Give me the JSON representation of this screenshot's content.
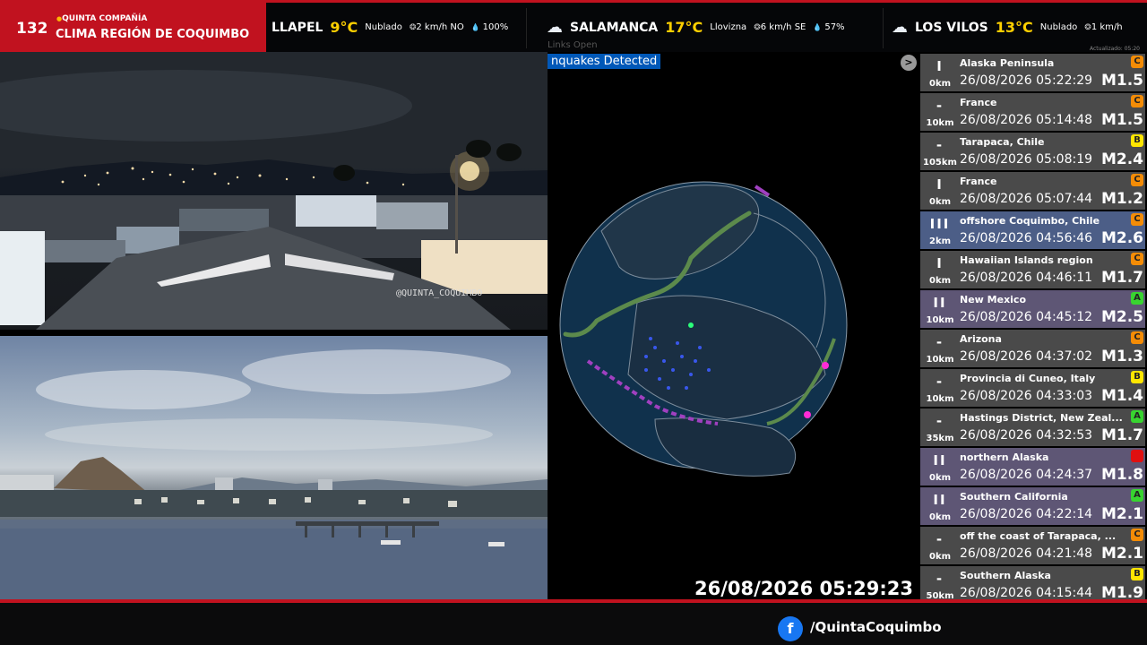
{
  "brand": {
    "channel_number": "132",
    "subtitle": "QUINTA COMPAÑÍA",
    "title": "CLIMA REGIÓN DE COQUIMBO"
  },
  "weather": [
    {
      "city": "LLAPEL",
      "temp": "9°C",
      "condition": "Nublado",
      "wind": "2 km/h NO",
      "humidity": "100%",
      "icon": "cloud-icon"
    },
    {
      "city": "SALAMANCA",
      "temp": "17°C",
      "condition": "Llovizna",
      "wind": "6 km/h SE",
      "humidity": "57%",
      "icon": "drizzle-icon"
    },
    {
      "city": "LOS VILOS",
      "temp": "13°C",
      "condition": "Nublado",
      "wind": "1 km/h",
      "humidity": "",
      "icon": "cloud-icon"
    }
  ],
  "ticker_updated": "Actualizado: 05:20",
  "cameras": {
    "top_watermark": "@QUINTA_COQUIMBO"
  },
  "map": {
    "hint_text": "Links  Open",
    "banner": "nquakes Detected",
    "close_label": ">",
    "clock": "26/08/2026 05:29:23"
  },
  "quakes": [
    {
      "place": "Alaska Peninsula",
      "time": "26/08/2026 05:22:29",
      "mag": "M1.5",
      "depth": "0km",
      "bars": "I",
      "src": "C",
      "src_color": "#f48c06",
      "tint": ""
    },
    {
      "place": "France",
      "time": "26/08/2026 05:14:48",
      "mag": "M1.5",
      "depth": "10km",
      "bars": "-",
      "src": "C",
      "src_color": "#f48c06",
      "tint": ""
    },
    {
      "place": "Tarapaca, Chile",
      "time": "26/08/2026 05:08:19",
      "mag": "M2.4",
      "depth": "105km",
      "bars": "-",
      "src": "B",
      "src_color": "#ffe600",
      "tint": ""
    },
    {
      "place": "France",
      "time": "26/08/2026 05:07:44",
      "mag": "M1.2",
      "depth": "0km",
      "bars": "I",
      "src": "C",
      "src_color": "#f48c06",
      "tint": ""
    },
    {
      "place": "offshore Coquimbo, Chile",
      "time": "26/08/2026 04:56:46",
      "mag": "M2.6",
      "depth": "2km",
      "bars": "III",
      "src": "C",
      "src_color": "#f48c06",
      "tint": "mag3"
    },
    {
      "place": "Hawaiian Islands region",
      "time": "26/08/2026 04:46:11",
      "mag": "M1.7",
      "depth": "0km",
      "bars": "I",
      "src": "C",
      "src_color": "#f48c06",
      "tint": ""
    },
    {
      "place": "New Mexico",
      "time": "26/08/2026 04:45:12",
      "mag": "M2.5",
      "depth": "10km",
      "bars": "II",
      "src": "A",
      "src_color": "#38d430",
      "tint": "mag2"
    },
    {
      "place": "Arizona",
      "time": "26/08/2026 04:37:02",
      "mag": "M1.3",
      "depth": "10km",
      "bars": "-",
      "src": "C",
      "src_color": "#f48c06",
      "tint": ""
    },
    {
      "place": "Provincia di Cuneo, Italy",
      "time": "26/08/2026 04:33:03",
      "mag": "M1.4",
      "depth": "10km",
      "bars": "-",
      "src": "B",
      "src_color": "#ffe600",
      "tint": ""
    },
    {
      "place": "Hastings District, New Zeal...",
      "time": "26/08/2026 04:32:53",
      "mag": "M1.7",
      "depth": "35km",
      "bars": "-",
      "src": "A",
      "src_color": "#38d430",
      "tint": ""
    },
    {
      "place": "northern Alaska",
      "time": "26/08/2026 04:24:37",
      "mag": "M1.8",
      "depth": "0km",
      "bars": "II",
      "src": "",
      "src_color": "#e01010",
      "tint": "mag2"
    },
    {
      "place": "Southern California",
      "time": "26/08/2026 04:22:14",
      "mag": "M2.1",
      "depth": "0km",
      "bars": "II",
      "src": "A",
      "src_color": "#38d430",
      "tint": "mag2"
    },
    {
      "place": "off the coast of Tarapaca, ...",
      "time": "26/08/2026 04:21:48",
      "mag": "M2.1",
      "depth": "0km",
      "bars": "-",
      "src": "C",
      "src_color": "#f48c06",
      "tint": ""
    },
    {
      "place": "Southern Alaska",
      "time": "26/08/2026 04:15:44",
      "mag": "M1.9",
      "depth": "50km",
      "bars": "-",
      "src": "B",
      "src_color": "#ffe600",
      "tint": ""
    }
  ],
  "footer": {
    "facebook_handle": "/QuintaCoquimbo"
  }
}
